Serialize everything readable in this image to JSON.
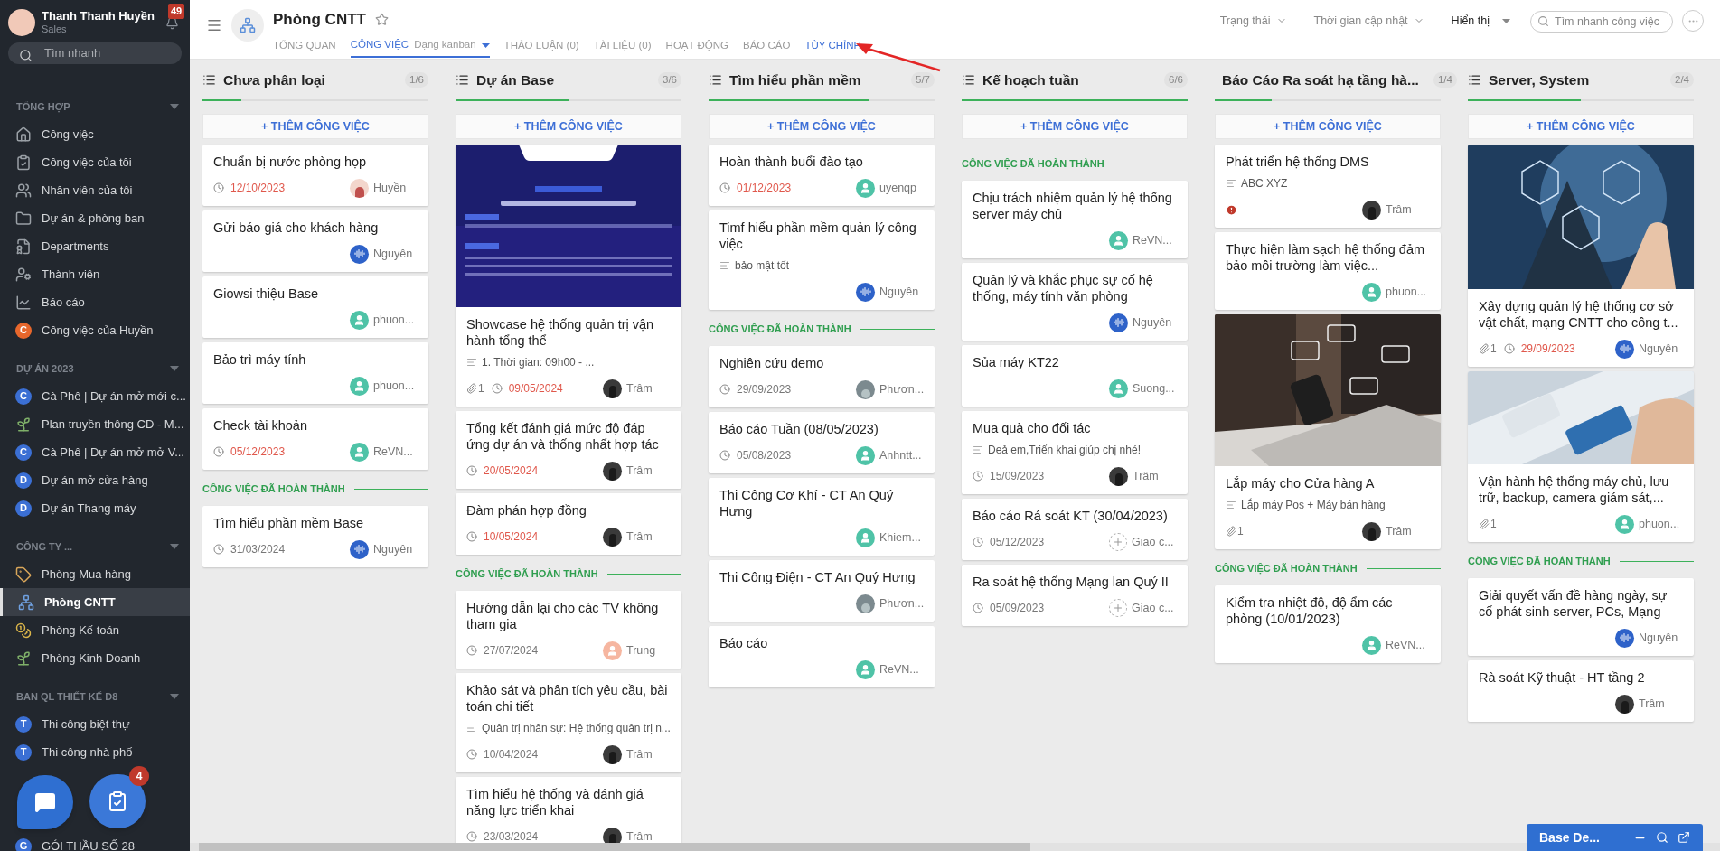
{
  "user": {
    "name": "Thanh Thanh Huyền",
    "role": "Sales",
    "notifications": "49"
  },
  "sidebar": {
    "search": {
      "placeholder": "Tìm nhanh"
    },
    "sections": [
      {
        "title": "TỔNG HỢP",
        "items": [
          {
            "kind": "home",
            "label": "Công việc",
            "selected": false
          },
          {
            "kind": "task",
            "label": "Công việc của tôi",
            "selected": false
          },
          {
            "kind": "people",
            "label": "Nhân viên của tôi",
            "selected": false
          },
          {
            "kind": "folder",
            "label": "Dự án & phòng ban",
            "selected": false
          },
          {
            "kind": "department",
            "label": "Departments",
            "selected": false
          },
          {
            "kind": "member",
            "label": "Thành viên",
            "selected": false
          },
          {
            "kind": "chart",
            "label": "Báo cáo",
            "selected": false
          },
          {
            "kind": "letter",
            "letter": "C",
            "color": "#e8672c",
            "label": "Công việc của Huyền",
            "selected": false
          }
        ]
      },
      {
        "title": "DỰ ÁN 2023",
        "items": [
          {
            "kind": "letter",
            "letter": "C",
            "color": "#3b6fd4",
            "label": "Cà Phê | Dự án mở mới c...",
            "selected": false
          },
          {
            "kind": "plant",
            "label": "Plan truyền thông CD - M...",
            "selected": false
          },
          {
            "kind": "letter",
            "letter": "C",
            "color": "#3b6fd4",
            "label": "Cà Phê | Dự án mở mở V...",
            "selected": false
          },
          {
            "kind": "letter",
            "letter": "D",
            "color": "#3b6fd4",
            "label": "Dự án mở cửa hàng",
            "selected": false
          },
          {
            "kind": "letter",
            "letter": "D",
            "color": "#3b6fd4",
            "label": "Dự án Thang máy",
            "selected": false
          }
        ]
      },
      {
        "title": "CÔNG TY ...",
        "items": [
          {
            "kind": "tag",
            "label": "Phòng Mua hàng",
            "selected": false
          },
          {
            "kind": "tree",
            "label": "Phòng CNTT",
            "selected": true
          },
          {
            "kind": "coins",
            "label": "Phòng Kế toán",
            "selected": false
          },
          {
            "kind": "plant",
            "label": "Phòng Kinh Doanh",
            "selected": false
          }
        ]
      },
      {
        "title": "BAN QL THIẾT KẾ D8",
        "items": [
          {
            "kind": "letter",
            "letter": "T",
            "color": "#3b6fd4",
            "label": "Thi công biệt thự",
            "selected": false
          },
          {
            "kind": "letter",
            "letter": "T",
            "color": "#3b6fd4",
            "label": "Thi công nhà phố",
            "selected": false
          }
        ]
      },
      {
        "items": [
          {
            "kind": "letter",
            "letter": "G",
            "color": "#3b6fd4",
            "label": "GÓI THẦU SỐ 28",
            "selected": false
          }
        ]
      }
    ]
  },
  "header": {
    "title": "Phòng CNTT",
    "tabs": [
      {
        "label": "TỔNG QUAN",
        "selected": false
      },
      {
        "label": "CÔNG VIỆC",
        "view": "Dạng kanban",
        "selected": true
      },
      {
        "label": "THẢO LUẬN (0)",
        "selected": false
      },
      {
        "label": "TÀI LIỆU (0)",
        "selected": false
      },
      {
        "label": "HOẠT ĐỘNG",
        "selected": false
      },
      {
        "label": "BÁO CÁO",
        "selected": false
      },
      {
        "label": "TÙY CHỈNH",
        "selected": false,
        "highlighted": true
      }
    ],
    "filters": [
      {
        "label": "Trạng thái",
        "kind": "muted"
      },
      {
        "label": "Thời gian cập nhật",
        "kind": "muted"
      },
      {
        "label": "Hiển thị",
        "kind": "strong"
      }
    ],
    "search": {
      "placeholder": "Tìm nhanh công việc"
    }
  },
  "columns": [
    {
      "title": "Chưa phân loại",
      "count": "1/6",
      "level": 0.17,
      "add": "+ THÊM CÔNG VIỆC",
      "tasks": [
        {
          "title": "Chuẩn bị nước phòng họp",
          "date": "12/10/2023",
          "overdue": true,
          "assignee": {
            "kind": "photo-light",
            "name": "Huyền"
          }
        },
        {
          "title": "Gửi báo giá cho khách hàng",
          "assignee": {
            "kind": "wave",
            "name": "Nguyên"
          }
        },
        {
          "title": "Giowsi thiệu Base",
          "assignee": {
            "kind": "person",
            "name": "phuon..."
          }
        },
        {
          "title": "Bảo trì máy tính",
          "assignee": {
            "kind": "person",
            "name": "phuon..."
          }
        },
        {
          "title": "Check tài khoản",
          "date": "05/12/2023",
          "overdue": true,
          "assignee": {
            "kind": "person",
            "name": "ReVN..."
          }
        }
      ],
      "done_label": "CÔNG VIỆC ĐÃ HOÀN THÀNH",
      "done": [
        {
          "title": "Tìm hiểu phần mềm Base",
          "date": "31/03/2024",
          "overdue": false,
          "assignee": {
            "kind": "wave",
            "name": "Nguyên"
          }
        }
      ]
    },
    {
      "title": "Dự án Base",
      "count": "3/6",
      "level": 0.5,
      "add": "+ THÊM CÔNG VIỆC",
      "tasks": [
        {
          "title": "Showcase hệ thống quản trị vận hành tổng thể",
          "description": "1. Thời gian: 09h00 - ...",
          "attachments": "1",
          "date": "09/05/2024",
          "overdue": true,
          "assignee": {
            "name": "Trâm"
          }
        },
        {
          "title": "Tổng kết đánh giá mức độ đáp ứng dự án và thống nhất hợp tác",
          "date": "20/05/2024",
          "overdue": true,
          "assignee": {
            "name": "Trâm"
          }
        },
        {
          "title": "Đàm phán hợp đồng",
          "date": "10/05/2024",
          "overdue": true,
          "assignee": {
            "name": "Trâm"
          }
        }
      ],
      "done_label": "CÔNG VIỆC ĐÃ HOÀN THÀNH",
      "done": [
        {
          "title": "Hướng dẫn lại cho các TV không tham gia",
          "date": "27/07/2024",
          "overdue": false,
          "assignee": {
            "kind": "peach",
            "name": "Trung"
          }
        },
        {
          "title": "Khảo sát và phân tích yêu cầu, bài toán chi tiết",
          "description": "Quản trị nhân sự: Hệ thống quản trị n...",
          "date": "10/04/2024",
          "overdue": false,
          "assignee": {
            "name": "Trâm"
          }
        },
        {
          "title": "Tìm hiểu hệ thống và đánh giá năng lực triển khai",
          "date": "23/03/2024",
          "overdue": false,
          "assignee": {
            "name": "Trâm"
          }
        }
      ]
    },
    {
      "title": "Tìm hiểu phần mềm",
      "count": "5/7",
      "level": 0.71,
      "add": "+ THÊM CÔNG VIỆC",
      "tasks": [
        {
          "title": "Hoàn thành buổi đào tạo",
          "date": "01/12/2023",
          "overdue": true,
          "assignee": {
            "kind": "person",
            "name": "uyenqp"
          }
        },
        {
          "title": "Timf hiểu phần mềm quản lý công việc",
          "description": "bảo mật tốt",
          "assignee": {
            "kind": "wave",
            "name": "Nguyên"
          }
        }
      ],
      "done_label": "CÔNG VIỆC ĐÃ HOÀN THÀNH",
      "done": [
        {
          "title": "Nghiên cứu demo",
          "date": "29/09/2023",
          "overdue": false,
          "assignee": {
            "kind": "photo-gray",
            "name": "Phươn..."
          }
        },
        {
          "title": "Báo cáo Tuần (08/05/2023)",
          "date": "05/08/2023",
          "overdue": false,
          "assignee": {
            "kind": "person",
            "name": "Anhntt..."
          }
        },
        {
          "title": "Thi Công Cơ Khí - CT An Quý Hưng",
          "assignee": {
            "kind": "person",
            "name": "Khiem..."
          }
        },
        {
          "title": "Thi Công Điện - CT An Quý Hưng",
          "assignee": {
            "kind": "photo-gray",
            "name": "Phươn..."
          }
        },
        {
          "title": "Báo cáo",
          "assignee": {
            "kind": "person",
            "name": "ReVN..."
          }
        }
      ]
    },
    {
      "title": "Kế hoạch tuần",
      "count": "6/6",
      "level": 1,
      "add": "+ THÊM CÔNG VIỆC",
      "done_label": "CÔNG VIỆC ĐÃ HOÀN THÀNH",
      "done": [
        {
          "title": "Chịu trách nhiệm quản lý hệ thống server máy chủ",
          "assignee": {
            "kind": "person",
            "name": "ReVN..."
          }
        },
        {
          "title": "Quản lý và khắc phục sự cố hệ thống, máy tính văn phòng",
          "assignee": {
            "kind": "wave",
            "name": "Nguyên"
          }
        },
        {
          "title": "Sủa máy KT22",
          "assignee": {
            "kind": "person",
            "name": "Suong..."
          }
        },
        {
          "title": "Mua quà cho đối tác",
          "description": "Deả em,Triển khai giúp chị nhé!",
          "date": "15/09/2023",
          "overdue": false,
          "assignee": {
            "name": "Trâm"
          }
        },
        {
          "title": "Báo cáo Rá soát KT (30/04/2023)",
          "date": "05/12/2023",
          "overdue": false,
          "assignee": {
            "kind": "add",
            "name": "Giao c..."
          }
        },
        {
          "title": "Ra soát hệ thống Mạng lan Quý II",
          "date": "05/09/2023",
          "overdue": false,
          "assignee": {
            "kind": "add",
            "name": "Giao c..."
          }
        }
      ]
    },
    {
      "title": "Báo Cáo Ra soát hạ tầng hà...",
      "count": "1/4",
      "level": 0.25,
      "add": "+ THÊM CÔNG VIỆC",
      "tasks": [
        {
          "title": "Phát triển hệ thống DMS",
          "description": "ABC XYZ",
          "alert": true,
          "assignee": {
            "name": "Trâm"
          }
        },
        {
          "title": "Thực hiện làm sạch hệ thống đảm bảo môi trường làm việc...",
          "assignee": {
            "kind": "person",
            "name": "phuon..."
          }
        },
        {
          "title": "Lắp máy cho Cửa hàng A",
          "description": "Lắp máy Pos + Máy bán hàng",
          "attachments": "1",
          "assignee": {
            "name": "Trâm"
          }
        }
      ],
      "done_label": "CÔNG VIỆC ĐÃ HOÀN THÀNH",
      "done": [
        {
          "title": "Kiểm tra nhiệt độ, độ ẩm các phòng (10/01/2023)",
          "assignee": {
            "kind": "person",
            "name": "ReVN..."
          }
        }
      ]
    },
    {
      "title": "Server, System",
      "count": "2/4",
      "level": 0.5,
      "add": "+ THÊM CÔNG VIỆC",
      "tasks": [
        {
          "title": "Xây dựng quản lý hệ thống cơ sở vật chất, mạng CNTT cho công t...",
          "attachments": "1",
          "date": "29/09/2023",
          "overdue": true,
          "assignee": {
            "kind": "wave",
            "name": "Nguyên"
          }
        },
        {
          "title": "Vận hành hệ thống máy chủ, lưu trữ, backup, camera giám sát,...",
          "attachments": "1",
          "assignee": {
            "kind": "person",
            "name": "phuon..."
          }
        }
      ],
      "done_label": "CÔNG VIỆC ĐÃ HOÀN THÀNH",
      "done": [
        {
          "title": "Giải quyết vấn đề hàng ngày, sự cố phát sinh server, PCs, Mạng",
          "assignee": {
            "kind": "wave",
            "name": "Nguyên"
          }
        },
        {
          "title": "Rà soát Kỹ thuật - HT tầng 2",
          "assignee": {
            "name": "Trâm"
          }
        }
      ]
    }
  ],
  "task_badge": "4",
  "mini_window": {
    "title": "Base De..."
  }
}
